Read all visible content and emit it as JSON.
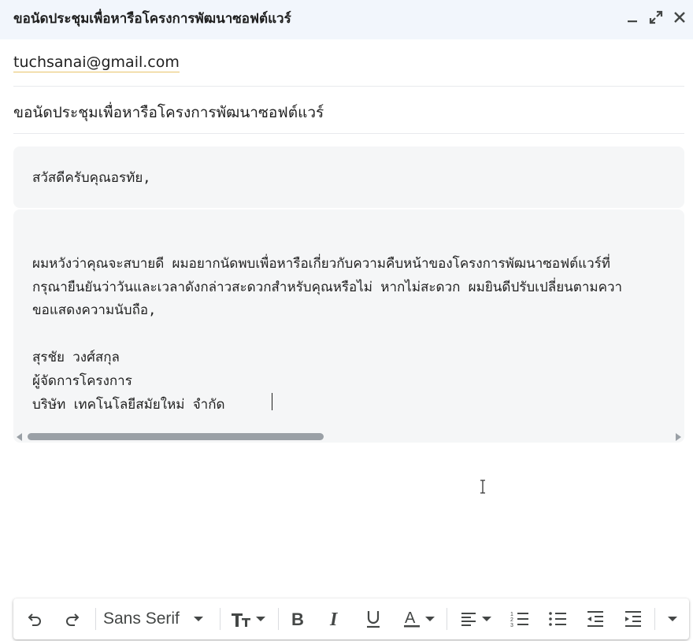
{
  "window": {
    "title": "ขอนัดประชุมเพื่อหารือโครงการพัฒนาซอฟต์แวร์",
    "controls": [
      "minimize-icon",
      "expand-icon",
      "close-icon"
    ]
  },
  "compose": {
    "recipient": "tuchsanai@gmail.com",
    "subject": "ขอนัดประชุมเพื่อหารือโครงการพัฒนาซอฟต์แวร์",
    "body": {
      "greeting": "สวัสดีครับคุณอรทัย,",
      "lines": [
        "ผมหวังว่าคุณจะสบายดี ผมอยากนัดพบเพื่อหารือเกี่ยวกับความคืบหน้าของโครงการพัฒนาซอฟต์แวร์ที่",
        "กรุณายืนยันว่าวันและเวลาดังกล่าวสะดวกสำหรับคุณหรือไม่ หากไม่สะดวก ผมยินดีปรับเปลี่ยนตามควา",
        "ขอแสดงความนับถือ,",
        "",
        "สุรชัย วงศ์สกุล",
        "ผู้จัดการโครงการ",
        "บริษัท เทคโนโลยีสมัยใหม่ จำกัด"
      ]
    }
  },
  "toolbar": {
    "font_family": "Sans Serif",
    "buttons": [
      "undo-icon",
      "redo-icon",
      "font-family-select",
      "text-size-icon",
      "bold-icon",
      "italic-icon",
      "underline-icon",
      "text-color-icon",
      "align-icon",
      "numbered-list-icon",
      "bulleted-list-icon",
      "indent-less-icon",
      "indent-more-icon",
      "more-formatting-icon"
    ]
  },
  "colors": {
    "header_bg": "#f2f6fc",
    "block_bg": "#f5f6f7",
    "icon": "#444746"
  }
}
